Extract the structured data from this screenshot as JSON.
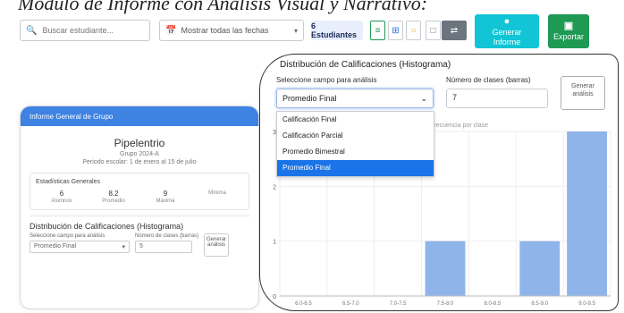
{
  "page": {
    "title": "Módulo de Informe con Análisis Visual y Narrativo:"
  },
  "toolbar": {
    "search_placeholder": "Buscar estudiante...",
    "filter_label": "Mostrar todas las fechas",
    "count_label": "6 Estudiantes",
    "view_icons": [
      "list-icon",
      "grid-icon",
      "circle-icon",
      "square-icon",
      "split-icon"
    ],
    "generate_label_1": "Generar",
    "generate_label_2": "Informe",
    "export_label": "Exportar"
  },
  "preview": {
    "header": "Informe General de Grupo",
    "title": "Pipelentrio",
    "subtitle_1": "Grupo 2024-A",
    "subtitle_2": "Periodo escolar: 1 de enero al 15 de julio",
    "box_heading": "Estadísticas Generales",
    "stats": [
      {
        "value": "6",
        "label": "Alumnos"
      },
      {
        "value": "8.2",
        "label": "Promedio"
      },
      {
        "value": "9",
        "label": "Máxima"
      },
      {
        "value": "",
        "label": "Mínima"
      }
    ],
    "section_heading": "Distribución de Calificaciones (Histograma)",
    "mini_select_label": "Seleccione campo para análisis",
    "mini_select_value": "Promedio Final",
    "mini_bins_label": "Número de clases (barras)",
    "mini_bins_value": "5",
    "mini_button": "Generar análisis"
  },
  "histogram": {
    "title": "Distribución de Calificaciones (Histograma)",
    "field_label": "Seleccione campo para análisis",
    "selected_value": "Promedio Final",
    "bins_label": "Número de clases (barras)",
    "bins_value": "7",
    "render_button": "Generar análisis",
    "options": [
      "Calificación Final",
      "Calificación Parcial",
      "Promedio Bimestral",
      "Promedio Final"
    ],
    "selected_option_index": 3,
    "chart_subtitle": "Frecuencia por clase"
  },
  "chart_data": {
    "type": "bar",
    "categories": [
      "6.0-6.5",
      "6.5-7.0",
      "7.0-7.5",
      "7.5-8.0",
      "8.0-8.5",
      "8.5-9.0",
      "9.0-9.5"
    ],
    "values": [
      0,
      0,
      0,
      1,
      0,
      1,
      3
    ],
    "ylim": [
      0,
      3
    ],
    "grid": true,
    "bar_color": "#8fb4ea"
  }
}
